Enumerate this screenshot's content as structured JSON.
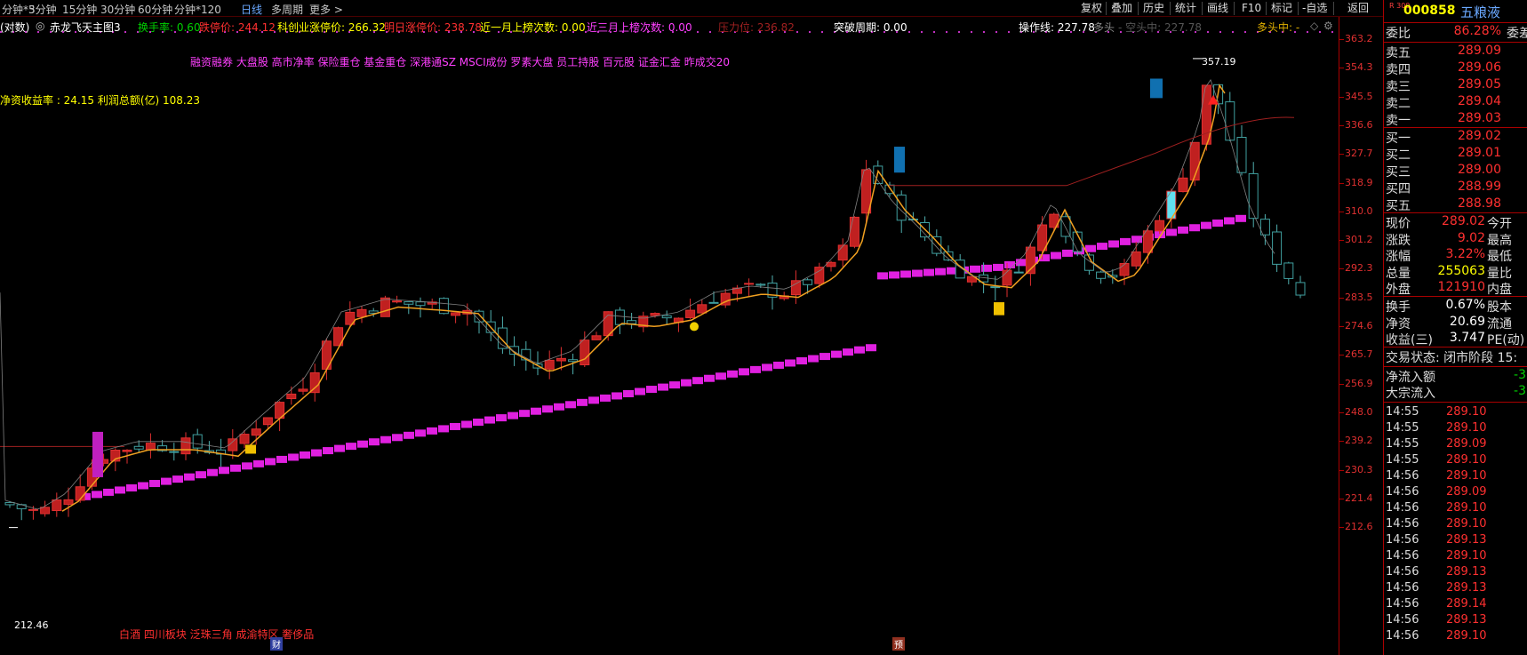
{
  "toolbar": {
    "periods": [
      "分钟*3",
      "5分钟",
      "15分钟",
      "30分钟",
      "60分钟",
      "分钟*120",
      "日线",
      "多周期",
      "更多 >"
    ],
    "right_buttons": [
      "复权",
      "叠加",
      "历史",
      "统计",
      "画线",
      "F10",
      "标记",
      "-自选",
      "返回"
    ]
  },
  "info_line": {
    "mode": "(对数)",
    "main_indicator": "赤龙飞天主图3",
    "turnover": "换手率: 0.60",
    "limit_down": "跌停价: 244.12",
    "kechuang_limit_up": "科创业涨停价: 266.32",
    "tomorrow_limit_up": "明日涨停价: 238.78",
    "month_list": "近一月上榜次数: 0.00",
    "three_month_list": "近三月上榜次数: 0.00",
    "pressure": "压力位: 236.82",
    "breakout": "突破周期: 0.00",
    "operation_line": "操作线: 227.78",
    "long_side": "多头 ",
    "short_mid": "- 空头中: 227.78",
    "bull_status": "多头中: -"
  },
  "concepts": "融资融券 大盘股 高市净率 保险重仓 基金重仓 深港通SZ MSCI成份 罗素大盘 员工持股 百元股 证金汇金 昨成交20",
  "finance": "净资收益率 : 24.15 利润总额(亿) 108.23",
  "bottom_concepts": "白酒 四川板块 泛珠三角 成渝特区 奢侈品",
  "annotations": {
    "high": "357.19",
    "low": "212.46",
    "bottom_tag_left": "财",
    "bottom_tag_right": "预"
  },
  "chart_data": {
    "type": "candlestick",
    "y_axis_ticks": [
      "363.2",
      "354.3",
      "345.5",
      "336.6",
      "327.7",
      "318.9",
      "310.0",
      "301.2",
      "292.3",
      "283.5",
      "274.6",
      "265.7",
      "256.9",
      "248.0",
      "239.2",
      "230.3",
      "221.4",
      "212.6"
    ],
    "high_marker": 357.19,
    "low_marker": 212.46
  },
  "panel": {
    "code": "000858",
    "name": "五粮液",
    "badge": "R 300",
    "weibi": {
      "label": "委比",
      "value": "86.28%",
      "right": "委差"
    },
    "asks": [
      {
        "label": "卖五",
        "price": "289.09"
      },
      {
        "label": "卖四",
        "price": "289.06"
      },
      {
        "label": "卖三",
        "price": "289.05"
      },
      {
        "label": "卖二",
        "price": "289.04"
      },
      {
        "label": "卖一",
        "price": "289.03"
      }
    ],
    "bids": [
      {
        "label": "买一",
        "price": "289.02"
      },
      {
        "label": "买二",
        "price": "289.01"
      },
      {
        "label": "买三",
        "price": "289.00"
      },
      {
        "label": "买四",
        "price": "288.99"
      },
      {
        "label": "买五",
        "price": "288.98"
      }
    ],
    "stats": [
      {
        "label": "现价",
        "value": "289.02",
        "right": "今开",
        "color": "red"
      },
      {
        "label": "涨跌",
        "value": "9.02",
        "right": "最高",
        "color": "red"
      },
      {
        "label": "涨幅",
        "value": "3.22%",
        "right": "最低",
        "color": "red"
      },
      {
        "label": "总量",
        "value": "255063",
        "right": "量比",
        "color": "yel"
      },
      {
        "label": "外盘",
        "value": "121910",
        "right": "内盘",
        "color": "red"
      }
    ],
    "stats2": [
      {
        "label": "换手",
        "value": "0.67%",
        "right": "股本",
        "color": "white"
      },
      {
        "label": "净资",
        "value": "20.69",
        "right": "流通",
        "color": "white"
      },
      {
        "label": "收益(三)",
        "value": "3.747",
        "right": "PE(动)",
        "color": "white"
      }
    ],
    "state": "交易状态: 闭市阶段 15:",
    "flows": [
      {
        "label": "净流入额",
        "value": "-3"
      },
      {
        "label": "大宗流入",
        "value": "-3"
      }
    ],
    "ticks": [
      {
        "t": "14:55",
        "p": "289.10"
      },
      {
        "t": "14:55",
        "p": "289.10"
      },
      {
        "t": "14:55",
        "p": "289.09"
      },
      {
        "t": "14:55",
        "p": "289.10"
      },
      {
        "t": "14:56",
        "p": "289.10"
      },
      {
        "t": "14:56",
        "p": "289.09"
      },
      {
        "t": "14:56",
        "p": "289.10"
      },
      {
        "t": "14:56",
        "p": "289.10"
      },
      {
        "t": "14:56",
        "p": "289.13"
      },
      {
        "t": "14:56",
        "p": "289.10"
      },
      {
        "t": "14:56",
        "p": "289.13"
      },
      {
        "t": "14:56",
        "p": "289.13"
      },
      {
        "t": "14:56",
        "p": "289.14"
      },
      {
        "t": "14:56",
        "p": "289.13"
      },
      {
        "t": "14:56",
        "p": "289.10"
      }
    ]
  }
}
